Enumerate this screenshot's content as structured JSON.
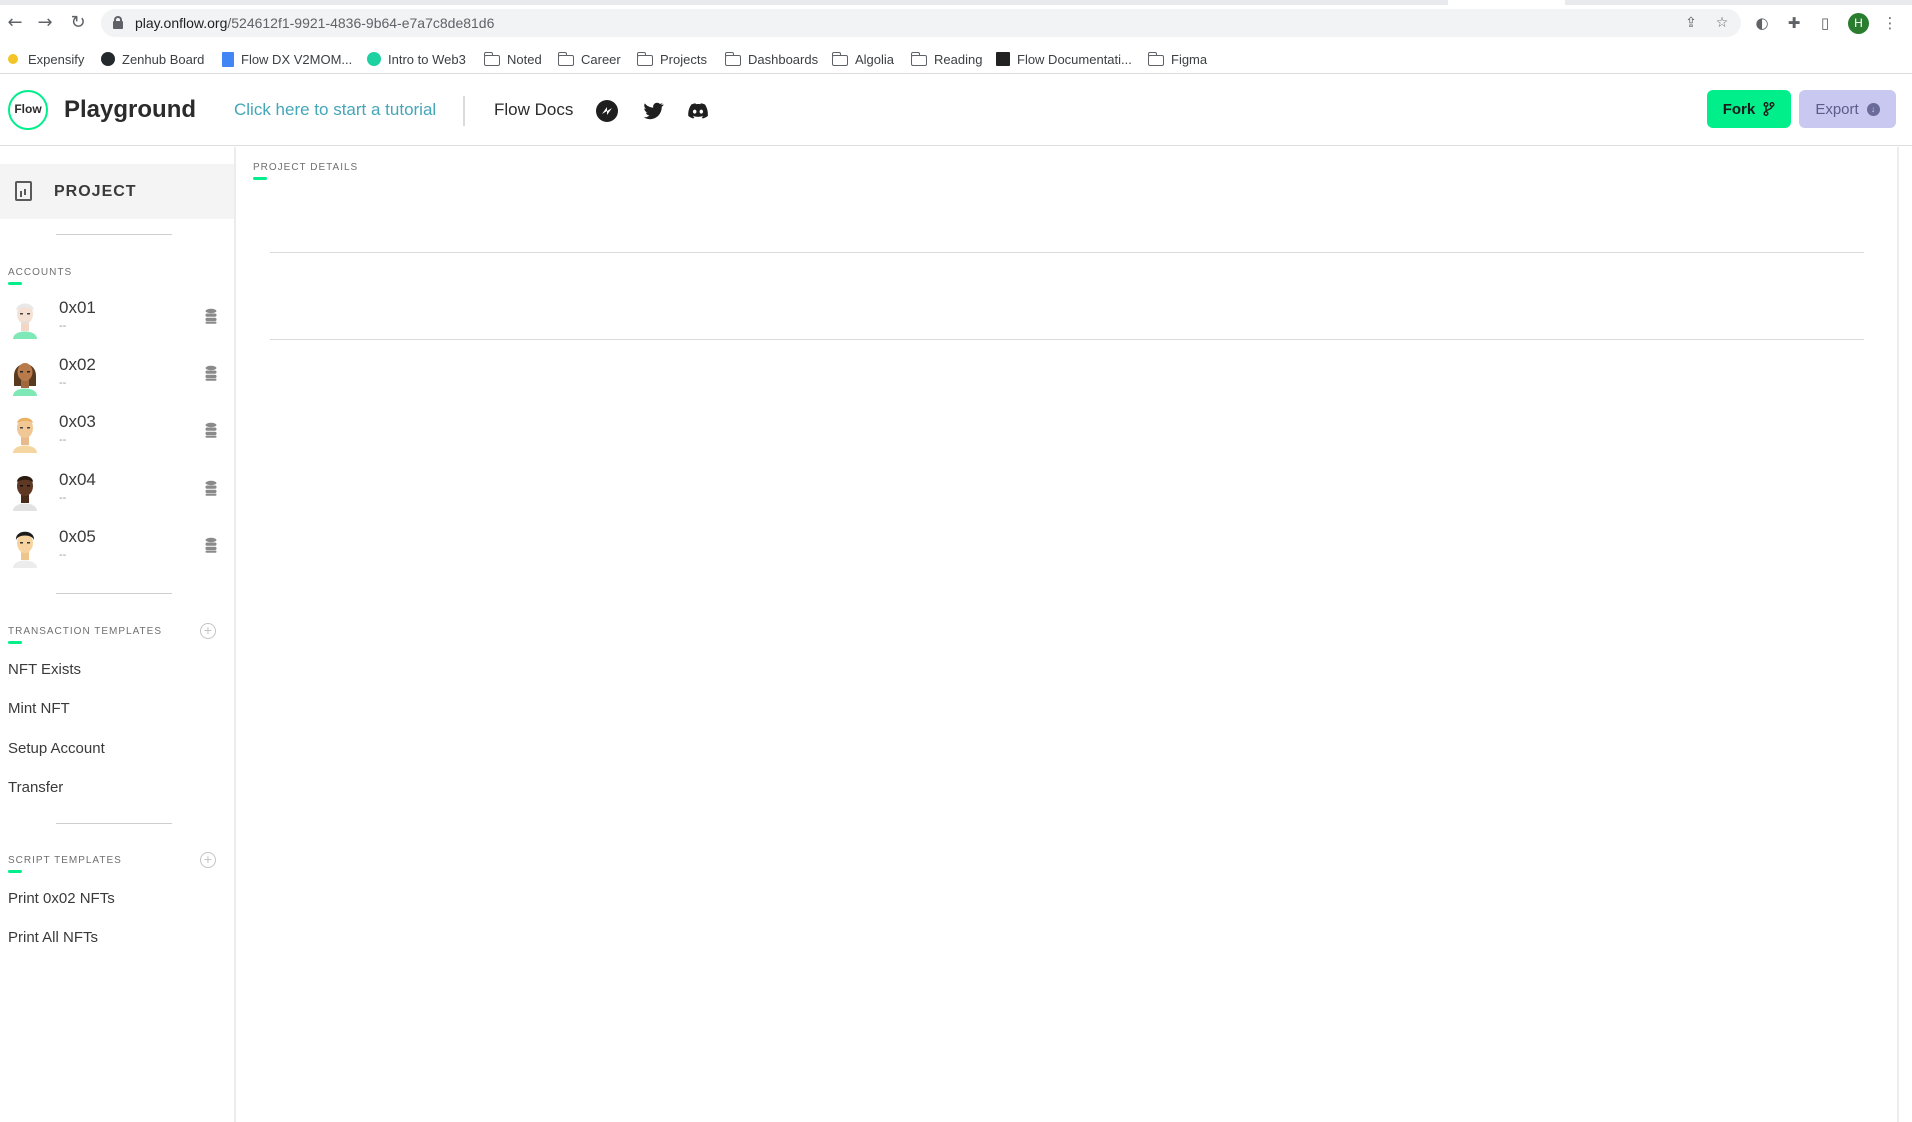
{
  "browser": {
    "url_host": "play.onflow.org",
    "url_path": "/524612f1-9921-4836-9b64-e7a7c8de81d6",
    "profile_initial": "H",
    "bookmarks": [
      {
        "label": "Expensify",
        "icon": "expensify-icon"
      },
      {
        "label": "Zenhub Board",
        "icon": "github-icon"
      },
      {
        "label": "Flow DX V2MOM...",
        "icon": "google-docs-icon"
      },
      {
        "label": "Intro to Web3",
        "icon": "web3-icon"
      },
      {
        "label": "Noted",
        "icon": "folder-icon"
      },
      {
        "label": "Career",
        "icon": "folder-icon"
      },
      {
        "label": "Projects",
        "icon": "folder-icon"
      },
      {
        "label": "Dashboards",
        "icon": "folder-icon"
      },
      {
        "label": "Algolia",
        "icon": "folder-icon"
      },
      {
        "label": "Reading",
        "icon": "folder-icon"
      },
      {
        "label": "Flow Documentati...",
        "icon": "flow-docs-icon"
      },
      {
        "label": "Figma",
        "icon": "folder-icon"
      }
    ]
  },
  "header": {
    "logo_text": "Flow",
    "title": "Playground",
    "tutorial_link": "Click here to start a tutorial",
    "docs_link": "Flow Docs",
    "fork_label": "Fork",
    "export_label": "Export",
    "accent_color": "#00ef8b"
  },
  "sidebar": {
    "project_label": "PROJECT",
    "accounts_title": "ACCOUNTS",
    "accounts": [
      {
        "address": "0x01",
        "sub": "--"
      },
      {
        "address": "0x02",
        "sub": "--"
      },
      {
        "address": "0x03",
        "sub": "--"
      },
      {
        "address": "0x04",
        "sub": "--"
      },
      {
        "address": "0x05",
        "sub": "--"
      }
    ],
    "transaction_templates_title": "TRANSACTION TEMPLATES",
    "transaction_templates": [
      "NFT Exists",
      "Mint NFT",
      "Setup Account",
      "Transfer"
    ],
    "script_templates_title": "SCRIPT TEMPLATES",
    "script_templates": [
      "Print 0x02 NFTs",
      "Print All NFTs"
    ]
  },
  "main": {
    "section_label": "PROJECT DETAILS"
  }
}
